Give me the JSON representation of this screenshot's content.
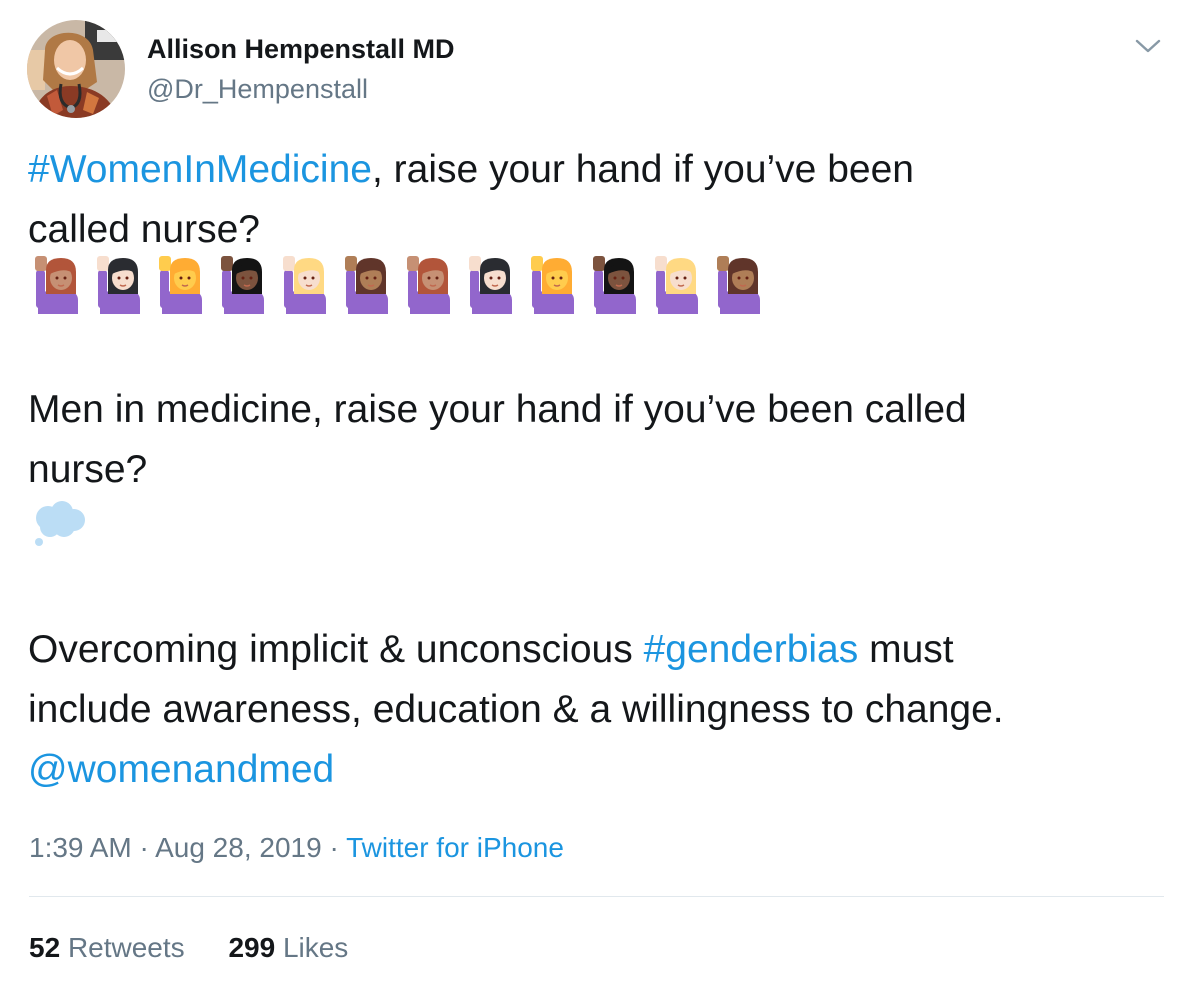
{
  "colors": {
    "text": "#14171a",
    "secondary": "#657786",
    "link": "#1b95e0",
    "divider": "#e1e8ed",
    "shirt_purple": "#9266cc"
  },
  "author": {
    "display_name": "Allison Hempenstall MD",
    "handle": "@Dr_Hempenstall",
    "avatar_icon": "profile-photo"
  },
  "tweet": {
    "line1": {
      "hashtag": "#WomenInMedicine",
      "rest": ", raise your hand if you’ve been"
    },
    "line2": "called nurse?",
    "women_raising_hand_emoji": [
      {
        "icon": "woman-raising-hand",
        "skin": "#c69074",
        "hair": "#b2553a"
      },
      {
        "icon": "woman-raising-hand",
        "skin": "#f7dece",
        "hair": "#2a2c31"
      },
      {
        "icon": "woman-raising-hand",
        "skin": "#ffcc4d",
        "hair": "#ffac33"
      },
      {
        "icon": "woman-raising-hand",
        "skin": "#7c533e",
        "hair": "#141414"
      },
      {
        "icon": "woman-raising-hand",
        "skin": "#f7dece",
        "hair": "#ffd983"
      },
      {
        "icon": "woman-raising-hand",
        "skin": "#af7e57",
        "hair": "#60352a"
      },
      {
        "icon": "woman-raising-hand",
        "skin": "#c69074",
        "hair": "#b2553a"
      },
      {
        "icon": "woman-raising-hand",
        "skin": "#f7dece",
        "hair": "#2a2c31"
      },
      {
        "icon": "woman-raising-hand",
        "skin": "#ffcc4d",
        "hair": "#ffac33"
      },
      {
        "icon": "woman-raising-hand",
        "skin": "#7c533e",
        "hair": "#141414"
      },
      {
        "icon": "woman-raising-hand",
        "skin": "#f7dece",
        "hair": "#ffd983"
      },
      {
        "icon": "woman-raising-hand",
        "skin": "#af7e57",
        "hair": "#60352a"
      }
    ],
    "line3": "Men in medicine, raise your hand if you’ve been called",
    "line4": "nurse?",
    "thought_emoji": "thought-balloon",
    "line5": {
      "before": "Overcoming implicit & unconscious ",
      "hashtag": "#genderbias",
      "after": " must"
    },
    "line6": "include awareness, education & a willingness to change.",
    "mention": "@womenandmed"
  },
  "meta": {
    "time": "1:39 AM",
    "separator": " · ",
    "date": "Aug 28, 2019",
    "source": "Twitter for iPhone"
  },
  "stats": {
    "retweets_count": "52",
    "retweets_label": "Retweets",
    "likes_count": "299",
    "likes_label": "Likes"
  }
}
